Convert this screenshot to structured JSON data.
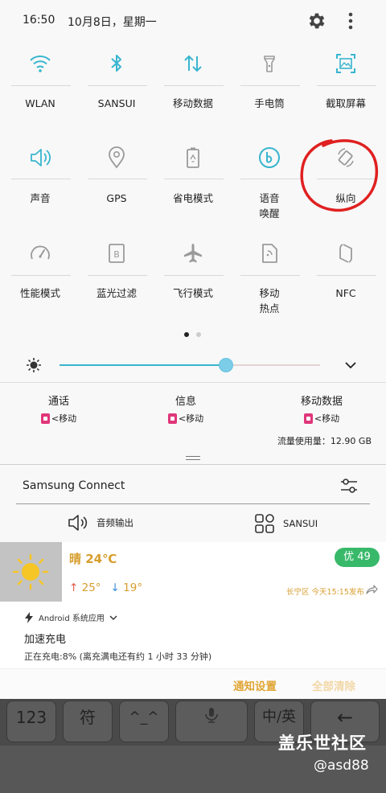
{
  "status": {
    "time": "16:50",
    "date": "10月8日，星期一"
  },
  "tiles": [
    {
      "label": "WLAN",
      "icon": "wifi-icon",
      "active": true
    },
    {
      "label": "SANSUI",
      "icon": "bluetooth-icon",
      "active": true
    },
    {
      "label": "移动数据",
      "icon": "mobile-data-icon",
      "active": true
    },
    {
      "label": "手电筒",
      "icon": "flashlight-icon",
      "active": false
    },
    {
      "label": "截取屏幕",
      "icon": "screenshot-icon",
      "active": true
    },
    {
      "label": "声音",
      "icon": "sound-icon",
      "active": true
    },
    {
      "label": "GPS",
      "icon": "location-icon",
      "active": false
    },
    {
      "label": "省电模式",
      "icon": "battery-saver-icon",
      "active": false
    },
    {
      "label": "语音\n唤醒",
      "icon": "bixby-icon",
      "active": true
    },
    {
      "label": "纵向",
      "icon": "rotation-icon",
      "active": false
    },
    {
      "label": "性能模式",
      "icon": "performance-icon",
      "active": false
    },
    {
      "label": "蓝光过滤",
      "icon": "blue-light-icon",
      "active": false
    },
    {
      "label": "飞行模式",
      "icon": "airplane-icon",
      "active": false
    },
    {
      "label": "移动\n热点",
      "icon": "hotspot-icon",
      "active": false
    },
    {
      "label": "NFC",
      "icon": "nfc-icon",
      "active": false
    }
  ],
  "brightness": {
    "level": 0.64
  },
  "usage": {
    "call": {
      "title": "通话",
      "sub": "<移动"
    },
    "message": {
      "title": "信息",
      "sub": "<移动"
    },
    "data": {
      "title": "移动数据",
      "sub": "<移动"
    },
    "data_used": "流量使用量：12.90 GB"
  },
  "connect": {
    "title": "Samsung Connect",
    "audio_output": "音频输出",
    "device": "SANSUI"
  },
  "weather": {
    "condition": "晴 24℃",
    "aqi": "优  49",
    "high": "25°",
    "low": "19°",
    "published": "长宁区  今天15:15发布"
  },
  "notification": {
    "app": "Android 系统应用",
    "title": "加速充电",
    "body": "正在充电:8% (离充满电还有约 1 小时 33 分钟)"
  },
  "actions": {
    "settings": "通知设置",
    "clear_all": "全部清除"
  },
  "keyboard": {
    "keys": [
      "123",
      "符",
      "^_^",
      "",
      "中/英",
      "←"
    ]
  },
  "watermark": {
    "line1": "盖乐世社区",
    "line2": "@asd88"
  },
  "colors": {
    "accent": "#38b5cf",
    "inactive": "#9a9a9a",
    "weather_text": "#d79e2e",
    "aqi_green": "#38b96a",
    "annotation_red": "#e02020"
  }
}
